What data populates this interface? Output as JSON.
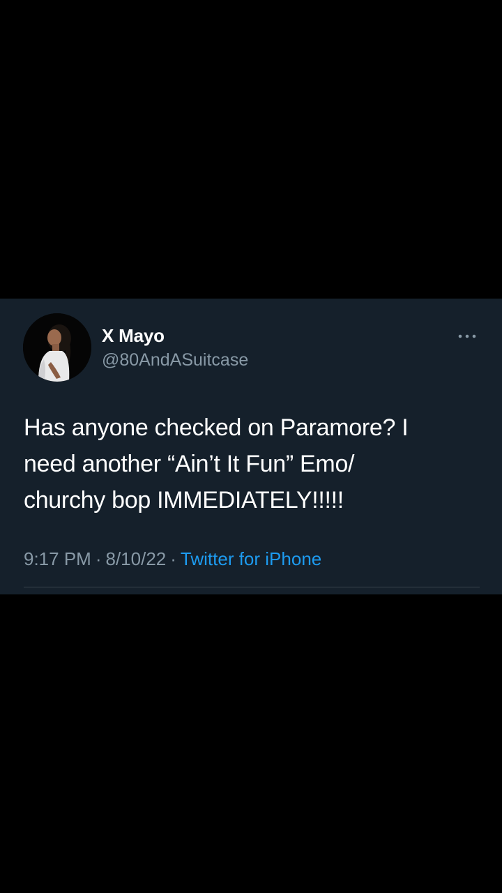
{
  "tweet": {
    "author": {
      "display_name": "X Mayo",
      "handle": "@80AndASuitcase",
      "avatar_icon": "profile-photo"
    },
    "more_icon": "ellipsis-icon",
    "text": "Has anyone checked on Paramore? I\nneed another “Ain’t It Fun” Emo/\nchurchy bop IMMEDIATELY!!!!!",
    "time": "9:17 PM",
    "separator": "·",
    "date": "8/10/22",
    "source": "Twitter for iPhone"
  },
  "colors": {
    "page_background": "#000000",
    "card_background": "#15202b",
    "primary_text": "#ffffff",
    "secondary_text": "#8899a6",
    "link": "#1d9bf0",
    "divider": "#38444d"
  }
}
